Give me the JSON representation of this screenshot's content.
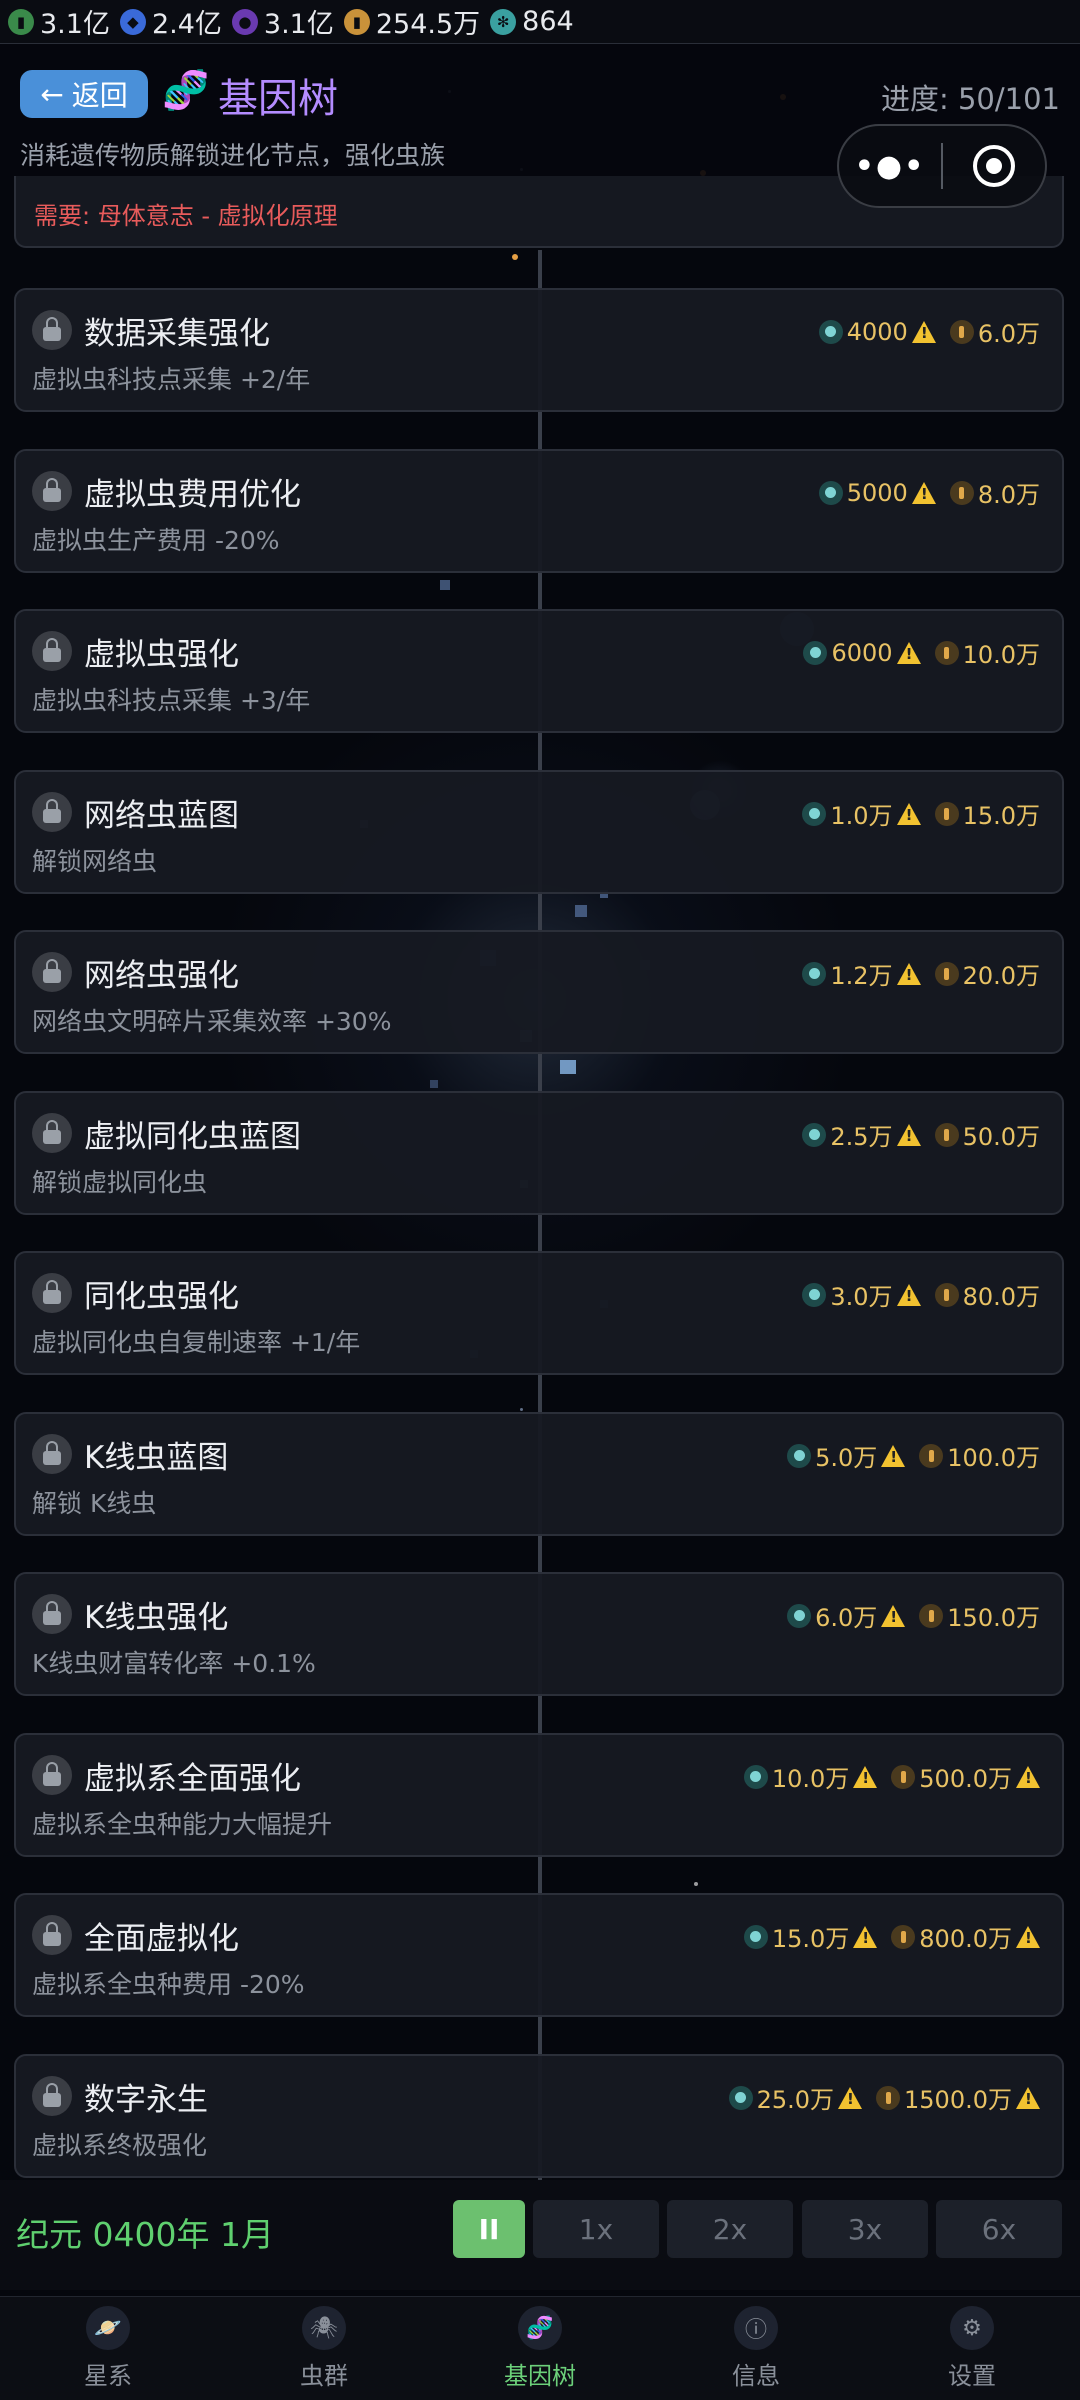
{
  "resources": [
    {
      "icon": "chip-icon",
      "value": "3.1亿",
      "color": "#3a8a4a"
    },
    {
      "icon": "diamond-icon",
      "value": "2.4亿",
      "color": "#3a6ad9"
    },
    {
      "icon": "orb-icon",
      "value": "3.1亿",
      "color": "#6a3ab0"
    },
    {
      "icon": "coin-icon",
      "value": "254.5万",
      "color": "#c9923a"
    },
    {
      "icon": "gear-gem-icon",
      "value": "864",
      "color": "#3aa0a0"
    }
  ],
  "header": {
    "back_label": "返回",
    "title": "基因树",
    "progress": "进度: 50/101",
    "subtitle": "消耗遗传物质解锁进化节点，强化虫族"
  },
  "partial_requirement": "需要: 母体意志 - 虚拟化原理",
  "nodes": [
    {
      "name": "数据采集强化",
      "desc": "虚拟虫科技点采集 +2/年",
      "gem_cost": "4000",
      "gem_warn": true,
      "coin_cost": "6.0万",
      "coin_warn": false
    },
    {
      "name": "虚拟虫费用优化",
      "desc": "虚拟虫生产费用 -20%",
      "gem_cost": "5000",
      "gem_warn": true,
      "coin_cost": "8.0万",
      "coin_warn": false
    },
    {
      "name": "虚拟虫强化",
      "desc": "虚拟虫科技点采集 +3/年",
      "gem_cost": "6000",
      "gem_warn": true,
      "coin_cost": "10.0万",
      "coin_warn": false
    },
    {
      "name": "网络虫蓝图",
      "desc": "解锁网络虫",
      "gem_cost": "1.0万",
      "gem_warn": true,
      "coin_cost": "15.0万",
      "coin_warn": false
    },
    {
      "name": "网络虫强化",
      "desc": "网络虫文明碎片采集效率 +30%",
      "gem_cost": "1.2万",
      "gem_warn": true,
      "coin_cost": "20.0万",
      "coin_warn": false
    },
    {
      "name": "虚拟同化虫蓝图",
      "desc": "解锁虚拟同化虫",
      "gem_cost": "2.5万",
      "gem_warn": true,
      "coin_cost": "50.0万",
      "coin_warn": false
    },
    {
      "name": "同化虫强化",
      "desc": "虚拟同化虫自复制速率 +1/年",
      "gem_cost": "3.0万",
      "gem_warn": true,
      "coin_cost": "80.0万",
      "coin_warn": false
    },
    {
      "name": "K线虫蓝图",
      "desc": "解锁 K线虫",
      "gem_cost": "5.0万",
      "gem_warn": true,
      "coin_cost": "100.0万",
      "coin_warn": false
    },
    {
      "name": "K线虫强化",
      "desc": "K线虫财富转化率 +0.1%",
      "gem_cost": "6.0万",
      "gem_warn": true,
      "coin_cost": "150.0万",
      "coin_warn": false
    },
    {
      "name": "虚拟系全面强化",
      "desc": "虚拟系全虫种能力大幅提升",
      "gem_cost": "10.0万",
      "gem_warn": true,
      "coin_cost": "500.0万",
      "coin_warn": true
    },
    {
      "name": "全面虚拟化",
      "desc": "虚拟系全虫种费用 -20%",
      "gem_cost": "15.0万",
      "gem_warn": true,
      "coin_cost": "800.0万",
      "coin_warn": true
    },
    {
      "name": "数字永生",
      "desc": "虚拟系终极强化",
      "gem_cost": "25.0万",
      "gem_warn": true,
      "coin_cost": "1500.0万",
      "coin_warn": true
    }
  ],
  "time": {
    "era": "纪元 0400年 1月",
    "pause_label": "II",
    "speeds": [
      "1x",
      "2x",
      "3x",
      "6x"
    ]
  },
  "nav": [
    {
      "label": "星系",
      "icon": "planet-icon",
      "active": false
    },
    {
      "label": "虫群",
      "icon": "bug-icon",
      "active": false
    },
    {
      "label": "基因树",
      "icon": "dna-icon",
      "active": true
    },
    {
      "label": "信息",
      "icon": "info-icon",
      "active": false
    },
    {
      "label": "设置",
      "icon": "gear-icon",
      "active": false
    }
  ],
  "colors": {
    "accent_green": "#6cc06f",
    "title_purple": "#b48cff",
    "warning_red": "#e85b5b",
    "cost_gold": "#e8c265"
  }
}
